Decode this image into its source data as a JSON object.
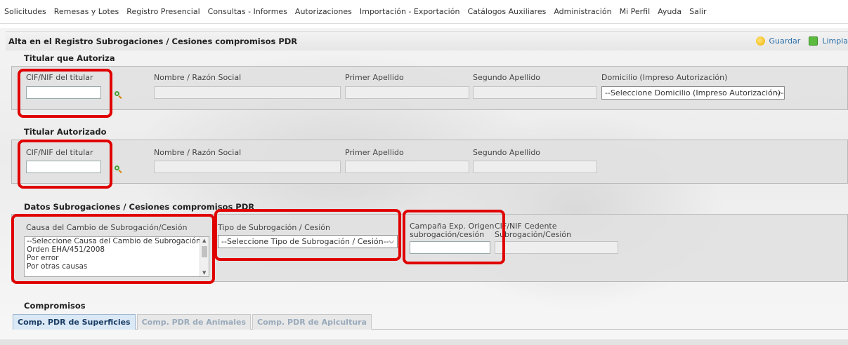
{
  "menu": {
    "items": [
      "Solicitudes",
      "Remesas y Lotes",
      "Registro Presencial",
      "Consultas - Informes",
      "Autorizaciones",
      "Importación - Exportación",
      "Catálogos Auxiliares",
      "Administración",
      "Mi Perfil",
      "Ayuda",
      "Salir"
    ]
  },
  "page": {
    "title": "Alta en el Registro Subrogaciones / Cesiones compromisos PDR",
    "save_label": "Guardar",
    "clean_label": "Limpia",
    "save_icon": "save-icon",
    "clean_icon": "clear-icon"
  },
  "titular_autoriza": {
    "section_title": "Titular que Autoriza",
    "cif_label": "CIF/NIF del titular",
    "cif_value": "",
    "nombre_label": "Nombre / Razón Social",
    "apellido1_label": "Primer Apellido",
    "apellido2_label": "Segundo Apellido",
    "domicilio_label": "Domicilio (Impreso Autorización)",
    "domicilio_selected": "--Seleccione Domicilio (Impreso Autorización)--"
  },
  "titular_autorizado": {
    "section_title": "Titular Autorizado",
    "cif_label": "CIF/NIF del titular",
    "cif_value": "",
    "nombre_label": "Nombre / Razón Social",
    "apellido1_label": "Primer Apellido",
    "apellido2_label": "Segundo Apellido"
  },
  "datos": {
    "section_title": "Datos Subrogaciones / Cesiones compromisos PDR",
    "causa_label": "Causa del Cambio de Subrogación/Cesión",
    "causa_options": [
      "--Seleccione Causa del Cambio de Subrogación/Ce",
      "Orden EHA/451/2008",
      "Por error",
      "Por otras causas"
    ],
    "tipo_label": "Tipo de Subrogación / Cesión",
    "tipo_selected": "--Seleccione Tipo de Subrogación / Cesión--",
    "campana_label_1": "Campaña Exp. Origen",
    "campana_label_2": "subrogación/cesión",
    "campana_value": "",
    "cedente_label_1": "CIF/NIF Cedente",
    "cedente_label_2": "Subrogación/Cesión"
  },
  "compromisos": {
    "section_title": "Compromisos",
    "tabs": [
      "Comp. PDR de Superficies",
      "Comp. PDR de Animales",
      "Comp. PDR de Apicultura"
    ]
  },
  "colors": {
    "highlight": "#e00000",
    "link": "#2a6fa8",
    "active_tab": "#dbe9f6"
  }
}
